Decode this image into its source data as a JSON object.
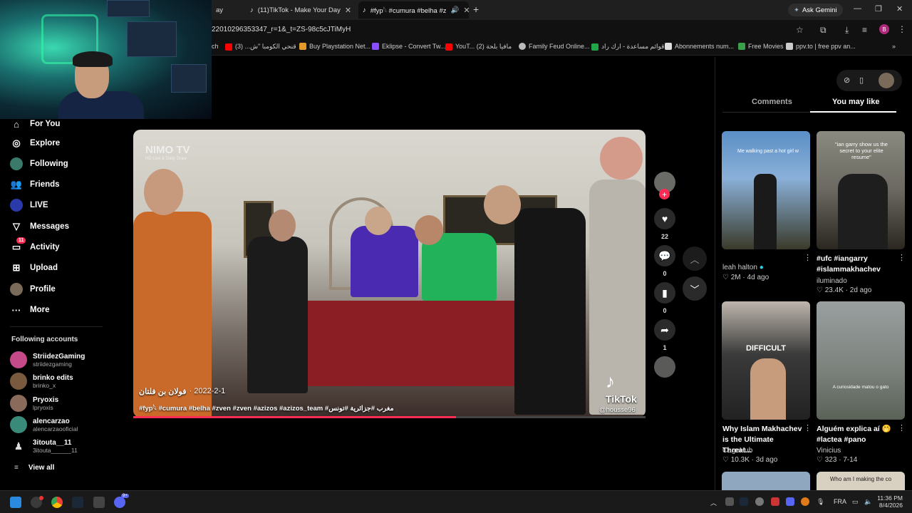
{
  "browser": {
    "tabs": [
      {
        "label": "ay",
        "active": false
      },
      {
        "label": "(11)TikTok - Make Your Day",
        "active": false
      },
      {
        "label": "#fyp𓆩 #cumura #belha #z",
        "active": true
      }
    ],
    "new_tab": "+",
    "ask_gemini": "Ask Gemini",
    "url": "22010296353347_r=1&_t=ZS-98c5cJTiMyH",
    "profile_initial": "B",
    "bookmarks": [
      {
        "label": "ch",
        "color": "#777"
      },
      {
        "label": "قنحي الكومبا \"ش... (3)",
        "color": "#ff0000"
      },
      {
        "label": "Buy Playstation Net...",
        "color": "#e39a2b"
      },
      {
        "label": "Eklipse - Convert Tw...",
        "color": "#8a4dff"
      },
      {
        "label": "YouT... مافيا بلحة (2)",
        "color": "#ff0000"
      },
      {
        "label": "Family Feud Online...",
        "color": "#bbbbbb"
      },
      {
        "label": "قوائم مساعدة - ارك راد...",
        "color": "#20a848"
      },
      {
        "label": "Abonnements num...",
        "color": "#dddddd"
      },
      {
        "label": "Free Movies",
        "color": "#3aa04a"
      },
      {
        "label": "ppv.to | free ppv an...",
        "color": "#cccccc"
      }
    ]
  },
  "sidebar": {
    "items": [
      {
        "label": "For You",
        "icon": "home-icon"
      },
      {
        "label": "Explore",
        "icon": "compass-icon"
      },
      {
        "label": "Following",
        "icon": "following-icon"
      },
      {
        "label": "Friends",
        "icon": "friends-icon"
      },
      {
        "label": "LIVE",
        "icon": "live-icon"
      },
      {
        "label": "Messages",
        "icon": "messages-icon"
      },
      {
        "label": "Activity",
        "icon": "activity-icon",
        "badge": "11"
      },
      {
        "label": "Upload",
        "icon": "upload-icon"
      },
      {
        "label": "Profile",
        "icon": "profile-icon"
      },
      {
        "label": "More",
        "icon": "more-icon"
      }
    ],
    "following_title": "Following accounts",
    "accounts": [
      {
        "name": "StriidezGaming",
        "handle": "striidezgaming",
        "color": "#c64a8a"
      },
      {
        "name": "brinko edits",
        "handle": "brinko_x",
        "color": "#7a5a3e"
      },
      {
        "name": "Pryoxis",
        "handle": "lpryoxis",
        "color": "#8a6a5a"
      },
      {
        "name": "alencarzao",
        "handle": "alencarzaooficial",
        "color": "#3a8a7a"
      },
      {
        "name": "3itouta__11",
        "handle": "3itouta______11",
        "color": "#dddddd"
      }
    ],
    "view_all": "View all"
  },
  "video": {
    "watermark_brand": "NIMO TV",
    "watermark_sub": "HD Live & Daily Draw",
    "author": "فولان بن فلتان",
    "date": "· 2022-2-1",
    "caption": "#fyp𓆩 #cumura #belha #zven #zven #azizos #azizos_team #مغرب #جزائرية #تونس",
    "tiktok_logo": "TikTok",
    "handle": "@housse96",
    "progress": 0.63
  },
  "actions": {
    "likes": "22",
    "comments": "0",
    "saves": "0",
    "shares": "1"
  },
  "right_panel": {
    "tabs": [
      {
        "label": "Comments",
        "active": false
      },
      {
        "label": "You may like",
        "active": true
      }
    ],
    "cards": [
      {
        "title": "",
        "author": "leah halton",
        "verified": true,
        "likes": "2M",
        "age": "4d ago",
        "overlay": "Me walking past a hot girl w",
        "bg": "#4b7fb0"
      },
      {
        "title": "#ufc #iangarry #islammakhachev",
        "author": "iluminado",
        "verified": false,
        "likes": "23.4K",
        "age": "2d ago",
        "overlay": "\"ian garry show us the secret to your elite resume\"",
        "bg": "#7a7a70"
      },
      {
        "title": "Why Islam Makhachev is the Ultimate Threat...",
        "author": "CageHub",
        "verified": false,
        "likes": "10.3K",
        "age": "3d ago",
        "overlay": "DIFFICULT",
        "bg": "#3a3a3a"
      },
      {
        "title": "Alguém explica aí 🤭 #lactea #pano",
        "author": "Vinicius",
        "verified": false,
        "likes": "323",
        "age": "7-14",
        "overlay": "A curiosidade matou o gato",
        "bg": "#8a8f8a"
      }
    ],
    "bottom_overlay": "Who am I making the co"
  },
  "taskbar": {
    "lang": "FRA",
    "time": "11:36 PM",
    "date": "8/4/2026",
    "discord_badge": "9+"
  }
}
